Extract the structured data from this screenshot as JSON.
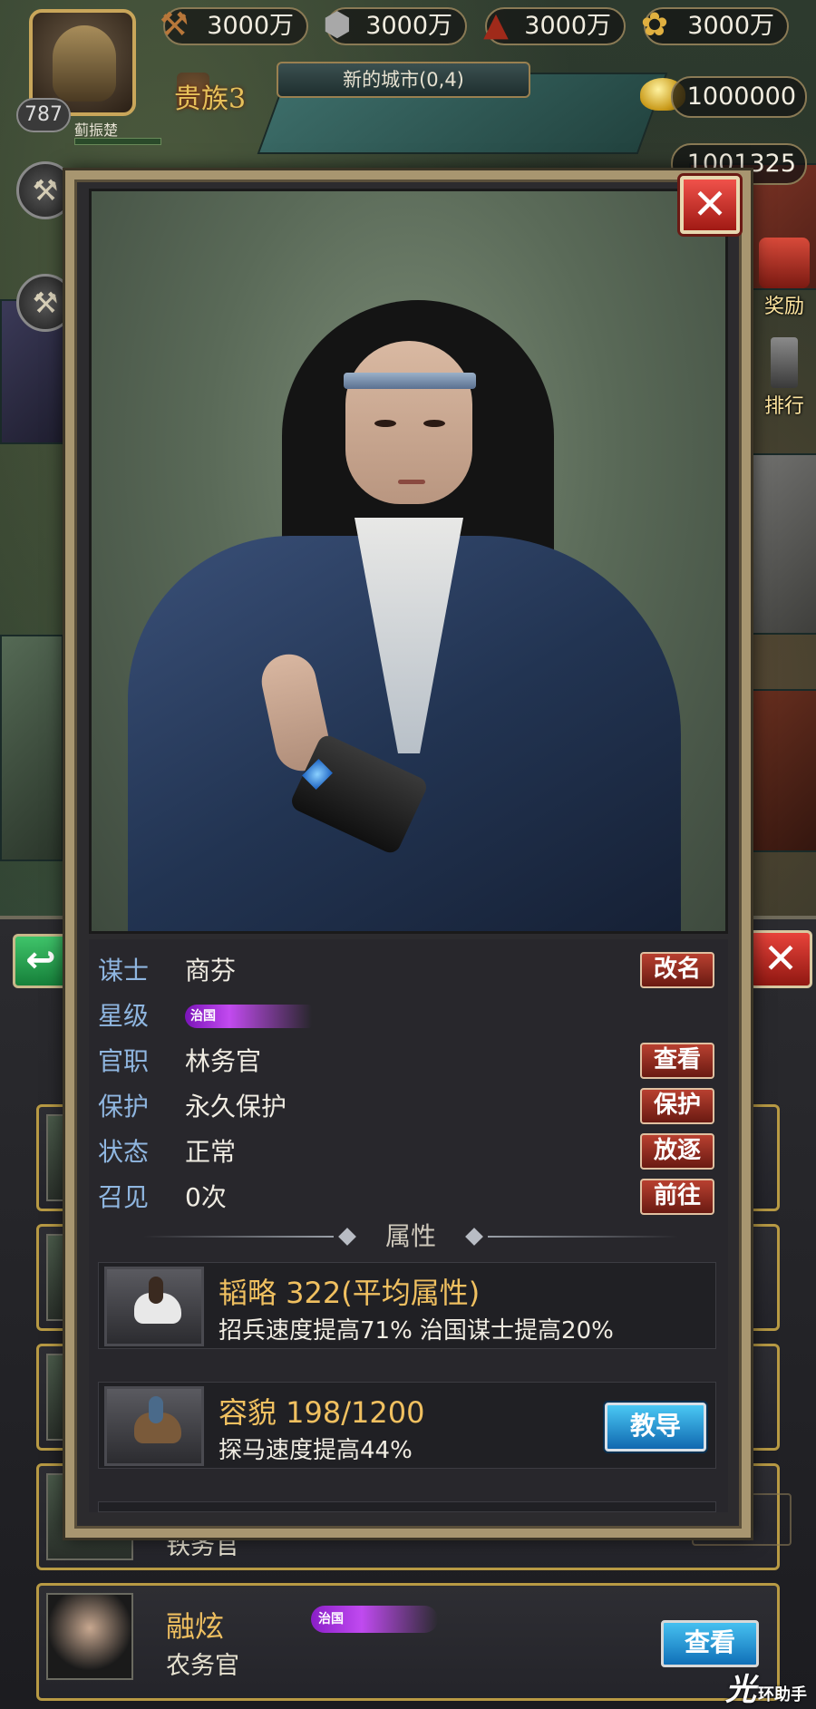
{
  "resources": {
    "wood": "3000万",
    "stone": "3000万",
    "iron": "3000万",
    "food": "3000万",
    "gold": "1000000",
    "silver": "1001325"
  },
  "player": {
    "level": "787",
    "name": "蓟振楚",
    "noble_rank": "贵族3",
    "city": "新的城市(0,4)"
  },
  "side_shortcuts": [
    {
      "label": "奖励",
      "icon": "gift-icon"
    },
    {
      "label": "排行",
      "icon": "sword-ranking-icon"
    }
  ],
  "list_rows": [
    {
      "title": "铁务官"
    },
    {
      "name": "融炫",
      "star": "治国",
      "title": "农务官",
      "button": "查看"
    }
  ],
  "detail": {
    "rows": [
      {
        "key": "谋士",
        "value": "商芬",
        "button": "改名"
      },
      {
        "key": "星级",
        "value": "治国",
        "button": ""
      },
      {
        "key": "官职",
        "value": "林务官",
        "button": "查看"
      },
      {
        "key": "保护",
        "value": "永久保护",
        "button": "保护"
      },
      {
        "key": "状态",
        "value": "正常",
        "button": "放逐"
      },
      {
        "key": "召见",
        "value": "0次",
        "button": "前往"
      }
    ],
    "section_title": "属性",
    "attributes": [
      {
        "name": "韬略 322(平均属性)",
        "desc": "招兵速度提高71% 治国谋士提高20%",
        "button": ""
      },
      {
        "name": "容貌 198/1200",
        "desc": "探马速度提高44%",
        "button": "教导"
      }
    ]
  },
  "watermark": {
    "big": "光",
    "text": "环助手"
  },
  "colors": {
    "key_blue": "#8fb6e0",
    "attr_gold": "#f0c060",
    "red_button": "#b84030",
    "blue_button": "#1068b0",
    "frame": "#a89670"
  }
}
